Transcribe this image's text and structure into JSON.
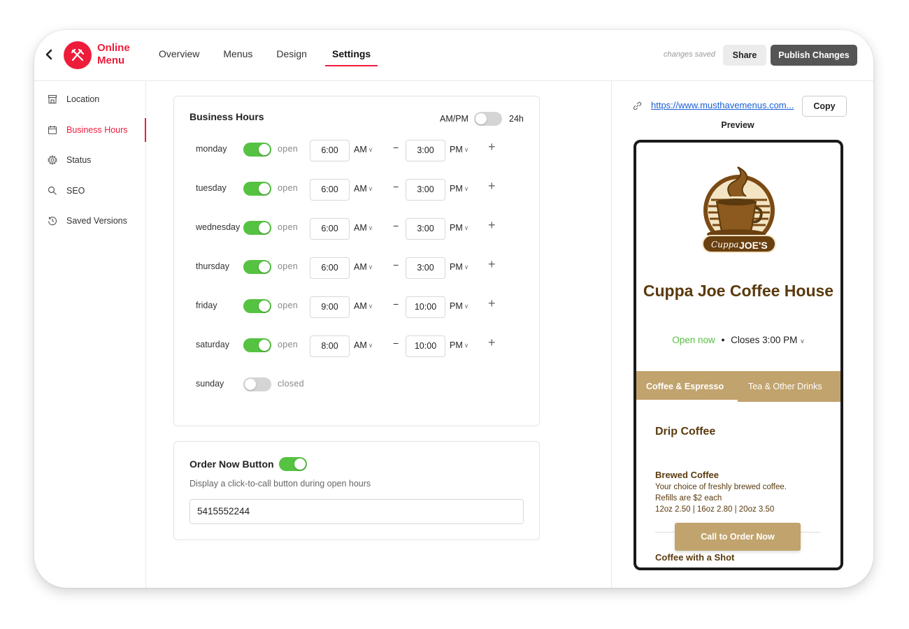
{
  "header": {
    "logo_line1": "Online",
    "logo_line2": "Menu",
    "tabs": [
      {
        "label": "Overview"
      },
      {
        "label": "Menus"
      },
      {
        "label": "Design"
      },
      {
        "label": "Settings"
      }
    ],
    "saved_status": "changes saved",
    "share_label": "Share",
    "publish_label": "Publish Changes",
    "brand_color": "#ee1c3b"
  },
  "sidebar": {
    "items": [
      {
        "label": "Location",
        "icon": "storefront-icon"
      },
      {
        "label": "Business Hours",
        "icon": "calendar-icon"
      },
      {
        "label": "Status",
        "icon": "gear-icon"
      },
      {
        "label": "SEO",
        "icon": "search-icon"
      },
      {
        "label": "Saved Versions",
        "icon": "history-icon"
      }
    ],
    "active": "Business Hours"
  },
  "business_hours": {
    "title": "Business Hours",
    "format_left": "AM/PM",
    "format_right": "24h",
    "days": [
      {
        "day": "monday",
        "state": "open",
        "from": "6:00",
        "from_period": "AM",
        "to": "3:00",
        "to_period": "PM"
      },
      {
        "day": "tuesday",
        "state": "open",
        "from": "6:00",
        "from_period": "AM",
        "to": "3:00",
        "to_period": "PM"
      },
      {
        "day": "wednesday",
        "state": "open",
        "from": "6:00",
        "from_period": "AM",
        "to": "3:00",
        "to_period": "PM"
      },
      {
        "day": "thursday",
        "state": "open",
        "from": "6:00",
        "from_period": "AM",
        "to": "3:00",
        "to_period": "PM"
      },
      {
        "day": "friday",
        "state": "open",
        "from": "9:00",
        "from_period": "AM",
        "to": "10:00",
        "to_period": "PM"
      },
      {
        "day": "saturday",
        "state": "open",
        "from": "8:00",
        "from_period": "AM",
        "to": "10:00",
        "to_period": "PM"
      },
      {
        "day": "sunday",
        "state": "closed"
      }
    ],
    "dash": "−",
    "plus": "+"
  },
  "order_now": {
    "title": "Order Now Button",
    "description": "Display a click-to-call button during open hours",
    "phone": "5415552244"
  },
  "preview": {
    "url": "https://www.musthavemenus.com...",
    "copy_label": "Copy",
    "label": "Preview",
    "logo_script": "Cuppa",
    "logo_word": "JOE'S",
    "cafe_name": "Cuppa Joe Coffee House",
    "open_status": "Open now",
    "closes": "Closes 3:00 PM",
    "tabs": [
      "Coffee & Espresso",
      "Tea & Other Drinks"
    ],
    "section": "Drip Coffee",
    "items": [
      {
        "name": "Brewed Coffee",
        "desc1": "Your choice of freshly brewed coffee.",
        "desc2": "Refills are $2 each",
        "prices": "12oz 2.50 | 16oz 2.80 | 20oz 3.50"
      },
      {
        "name": "Coffee with a Shot"
      }
    ],
    "cta_label": "Call to Order Now",
    "theme_color": "#c1a36e",
    "text_color": "#5a3a0e"
  }
}
